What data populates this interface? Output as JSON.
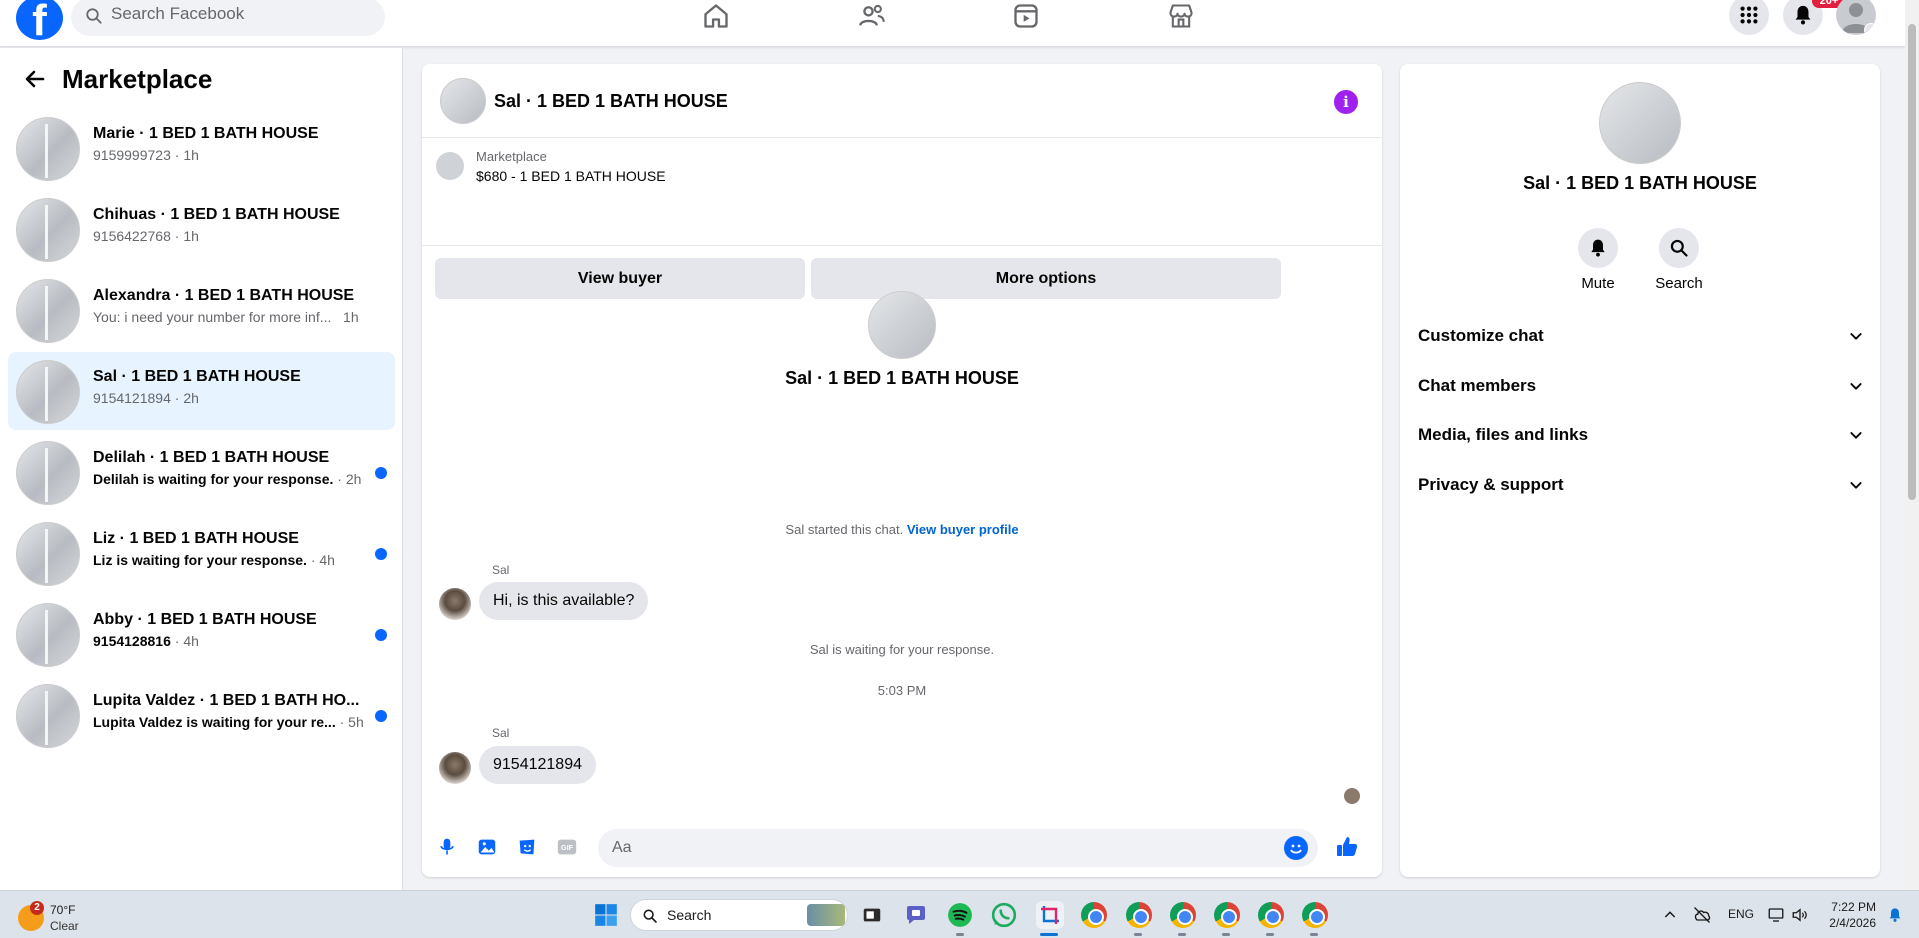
{
  "topbar": {
    "logo": "f",
    "search_placeholder": "Search Facebook",
    "nav_icons": [
      "home-icon",
      "friends-icon",
      "video-icon",
      "marketplace-icon"
    ],
    "notif_count": "20+"
  },
  "sidebar": {
    "title": "Marketplace",
    "conversations": [
      {
        "title": "Marie · 1 BED 1 BATH HOUSE",
        "sub": "9159999723",
        "time": " · 1h",
        "unread": false
      },
      {
        "title": "Chihuas · 1 BED 1 BATH HOUSE",
        "sub": "9156422768",
        "time": " · 1h",
        "unread": false
      },
      {
        "title": "Alexandra · 1 BED 1 BATH HOUSE",
        "sub": "You: i need your number for more inf...",
        "time": "   1h",
        "unread": false
      },
      {
        "title": "Sal · 1 BED 1 BATH HOUSE",
        "sub": "9154121894",
        "time": " · 2h",
        "unread": false,
        "active": true
      },
      {
        "title": "Delilah · 1 BED 1 BATH HOUSE",
        "sub": "Delilah is waiting for your response.",
        "time": " · 2h",
        "unread": true
      },
      {
        "title": "Liz · 1 BED 1 BATH HOUSE",
        "sub": "Liz is waiting for your response.",
        "time": " · 4h",
        "unread": true
      },
      {
        "title": "Abby · 1 BED 1 BATH HOUSE",
        "sub": "9154128816",
        "time": " · 4h",
        "unread": true
      },
      {
        "title": "Lupita Valdez · 1 BED 1 BATH HO...",
        "sub": "Lupita Valdez is waiting for your re...",
        "time": " · 5h",
        "unread": true
      }
    ]
  },
  "chat": {
    "name": "Sal · 1 BED 1 BATH HOUSE",
    "marketplace_label": "Marketplace",
    "listing": "$680 - 1 BED 1 BATH HOUSE",
    "view_buyer": "View buyer",
    "more_options": "More options",
    "profile_name": "Sal · 1 BED 1 BATH HOUSE",
    "started_text": "Sal started this chat.",
    "view_profile_link": "View buyer profile",
    "messages": [
      {
        "sender": "Sal",
        "text": "Hi, is this available?"
      },
      {
        "sender": "Sal",
        "text": "9154121894"
      }
    ],
    "waiting_text": "Sal is waiting for your response.",
    "timestamp": "5:03 PM",
    "composer_placeholder": "Aa"
  },
  "details": {
    "name": "Sal · 1 BED 1 BATH HOUSE",
    "mute": "Mute",
    "search": "Search",
    "sections": [
      "Customize chat",
      "Chat members",
      "Media, files and links",
      "Privacy & support"
    ]
  },
  "taskbar": {
    "weather_badge": "2",
    "temp": "70°F",
    "condition": "Clear",
    "search": "Search",
    "lang": "ENG",
    "time": "7:22 PM",
    "date": "2/4/2026"
  },
  "colors": {
    "accent": "#0866ff",
    "active_bg": "#e7f3ff",
    "info": "#a020f0"
  }
}
